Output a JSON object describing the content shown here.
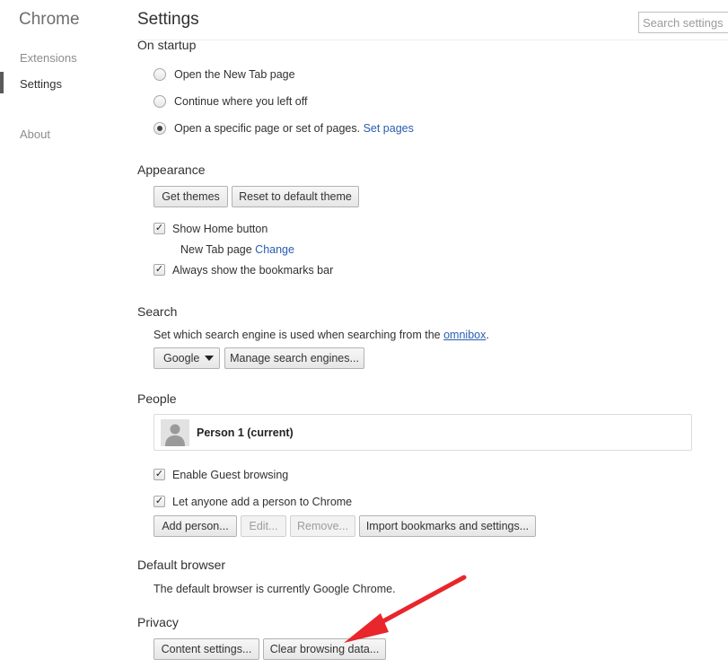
{
  "sidebar": {
    "brand": "Chrome",
    "items": [
      {
        "label": "Extensions",
        "active": false
      },
      {
        "label": "Settings",
        "active": true
      },
      {
        "label": "About",
        "active": false
      }
    ]
  },
  "header": {
    "title": "Settings",
    "search_placeholder": "Search settings"
  },
  "startup": {
    "heading": "On startup",
    "options": [
      {
        "label": "Open the New Tab page",
        "selected": false
      },
      {
        "label": "Continue where you left off",
        "selected": false
      },
      {
        "label": "Open a specific page or set of pages.",
        "selected": true,
        "link": "Set pages"
      }
    ]
  },
  "appearance": {
    "heading": "Appearance",
    "get_themes": "Get themes",
    "reset_theme": "Reset to default theme",
    "show_home": "Show Home button",
    "home_page_text": "New Tab page",
    "home_change": "Change",
    "show_bookmarks": "Always show the bookmarks bar"
  },
  "search": {
    "heading": "Search",
    "description": "Set which search engine is used when searching from the",
    "omnibox_link": "omnibox",
    "period": ".",
    "engine": "Google",
    "manage": "Manage search engines..."
  },
  "people": {
    "heading": "People",
    "person": "Person 1 (current)",
    "guest": "Enable Guest browsing",
    "anyone_add": "Let anyone add a person to Chrome",
    "add_person": "Add person...",
    "edit": "Edit...",
    "remove": "Remove...",
    "import": "Import bookmarks and settings..."
  },
  "default_browser": {
    "heading": "Default browser",
    "text": "The default browser is currently Google Chrome."
  },
  "privacy": {
    "heading": "Privacy",
    "content_settings": "Content settings...",
    "clear_data": "Clear browsing data..."
  },
  "annotation": {
    "arrow_color": "#e8262b"
  }
}
